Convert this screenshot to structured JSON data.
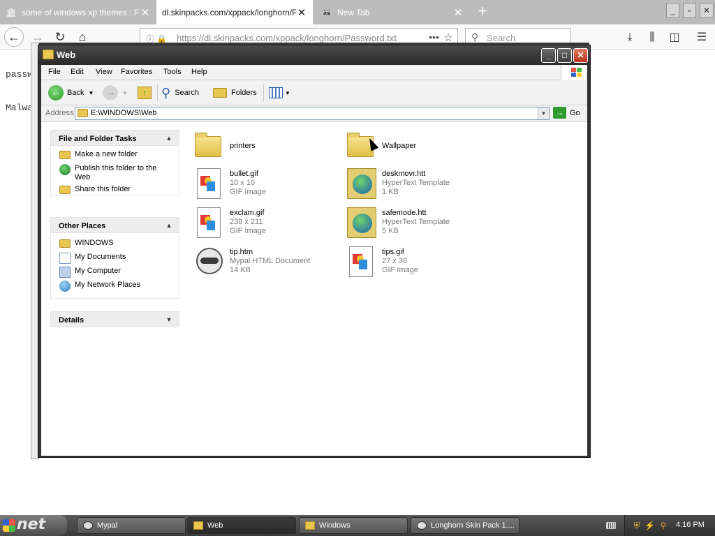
{
  "browser": {
    "tabs": [
      {
        "title": "some of windows xp themes : Fre",
        "icon": "museum-icon"
      },
      {
        "title": "dl.skinpacks.com/xppack/longhorn/Pas",
        "icon": "none"
      },
      {
        "title": "New Tab",
        "icon": "raccoon-icon"
      }
    ],
    "close_glyph": "✕",
    "new_tab_glyph": "+",
    "url": "https://dl.skinpacks.com/xppack/longhorn/Password.txt",
    "search_placeholder": "Search",
    "page_lines": [
      "passw",
      "Malwa"
    ]
  },
  "explorer": {
    "title": "Web",
    "menu": [
      "File",
      "Edit",
      "View",
      "Favorites",
      "Tools",
      "Help"
    ],
    "toolbar": {
      "back": "Back",
      "search": "Search",
      "folders": "Folders"
    },
    "address_label": "Address",
    "address_value": "E:\\WINDOWS\\Web",
    "go_label": "Go",
    "panels": {
      "file_tasks": {
        "title": "File and Folder Tasks",
        "items": [
          "Make a new folder",
          "Publish this folder to the Web",
          "Share this folder"
        ]
      },
      "other_places": {
        "title": "Other Places",
        "items": [
          "WINDOWS",
          "My Documents",
          "My Computer",
          "My Network Places"
        ]
      },
      "details": {
        "title": "Details"
      }
    },
    "files": [
      {
        "name": "printers",
        "line2": "",
        "line3": "",
        "icon": "folder-icon"
      },
      {
        "name": "Wallpaper",
        "line2": "",
        "line3": "",
        "icon": "folder-icon"
      },
      {
        "name": "bullet.gif",
        "line2": "10 x 10",
        "line3": "GIF Image",
        "icon": "gif-image-icon"
      },
      {
        "name": "deskmovr.htt",
        "line2": "HyperText Template",
        "line3": "1 KB",
        "icon": "hypertext-template-icon"
      },
      {
        "name": "exclam.gif",
        "line2": "238 x 211",
        "line3": "GIF Image",
        "icon": "gif-image-icon"
      },
      {
        "name": "safemode.htt",
        "line2": "HyperText Template",
        "line3": "5 KB",
        "icon": "hypertext-template-icon"
      },
      {
        "name": "tip.htm",
        "line2": "Mypal HTML Document",
        "line3": "14 KB",
        "icon": "mypal-document-icon"
      },
      {
        "name": "tips.gif",
        "line2": "27 x 36",
        "line3": "GIF Image",
        "icon": "gif-image-icon"
      }
    ]
  },
  "taskbar": {
    "start_label": "net",
    "buttons": [
      "Mypal",
      "Web",
      "Windows",
      "Longhorn Skin Pack 1...."
    ],
    "clock": "4:16 PM"
  },
  "colors": {
    "titlebar": "#2a2a2a",
    "taskbar": "#4a4a4a",
    "tab_strip": "#bcbcbc",
    "go_green": "#2e9b2c"
  }
}
